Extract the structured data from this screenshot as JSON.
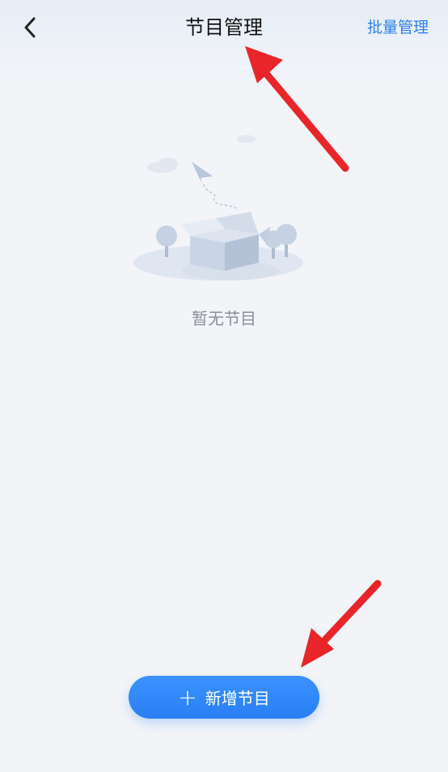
{
  "header": {
    "title": "节目管理",
    "right_action": "批量管理",
    "back_icon": "chevron-left-icon"
  },
  "empty_state": {
    "message": "暂无节目",
    "illustration": "empty-box-illustration"
  },
  "primary_action": {
    "icon": "plus-icon",
    "label": "新增节目"
  },
  "colors": {
    "background": "#f2f4f8",
    "accent": "#2f80ed",
    "button": "#2a7ff4",
    "annotation_arrow": "#e8262a"
  }
}
